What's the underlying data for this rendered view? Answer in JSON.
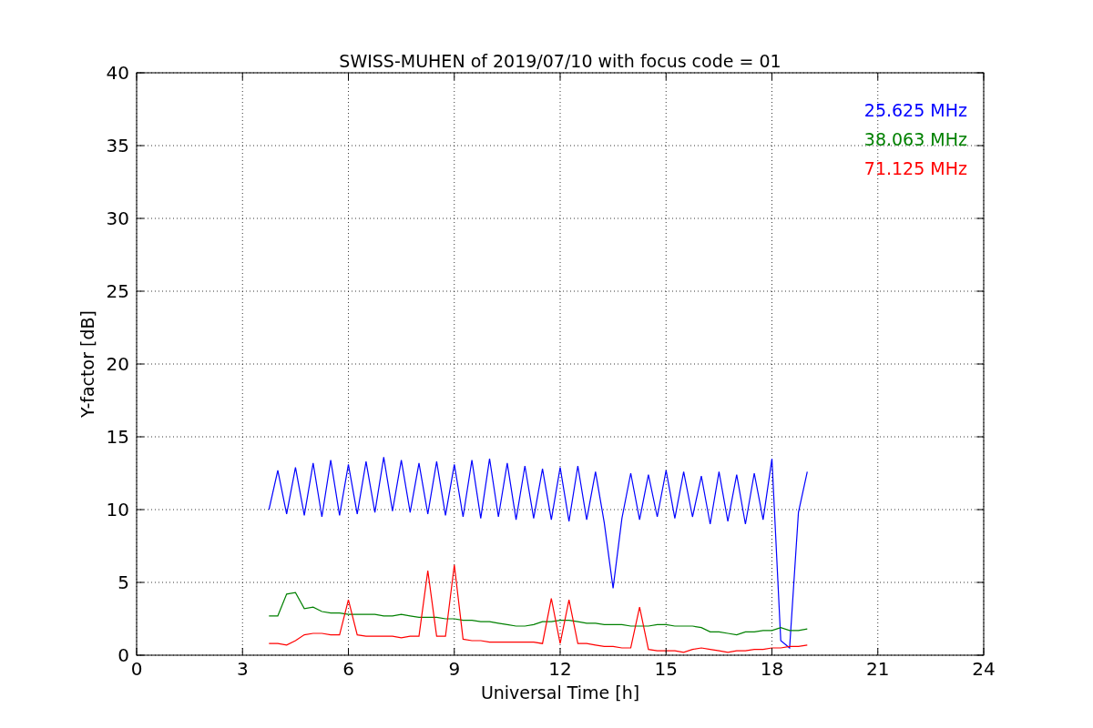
{
  "chart_data": {
    "type": "line",
    "title": "SWISS-MUHEN of 2019/07/10 with focus code = 01",
    "xlabel": "Universal Time [h]",
    "ylabel": "Y-factor [dB]",
    "x": [
      3.75,
      4,
      4.25,
      4.5,
      4.75,
      5,
      5.25,
      5.5,
      5.75,
      6,
      6.25,
      6.5,
      6.75,
      7,
      7.25,
      7.5,
      7.75,
      8,
      8.25,
      8.5,
      8.75,
      9,
      9.25,
      9.5,
      9.75,
      10,
      10.25,
      10.5,
      10.75,
      11,
      11.25,
      11.5,
      11.75,
      12,
      12.25,
      12.5,
      12.75,
      13,
      13.25,
      13.5,
      13.75,
      14,
      14.25,
      14.5,
      14.75,
      15,
      15.25,
      15.5,
      15.75,
      16,
      16.25,
      16.5,
      16.75,
      17,
      17.25,
      17.5,
      17.75,
      18,
      18.25,
      18.5,
      18.75,
      19
    ],
    "series": [
      {
        "name": "25.625 MHz",
        "color": "#0000ff",
        "values": [
          10,
          12.7,
          9.7,
          12.9,
          9.6,
          13.2,
          9.5,
          13.4,
          9.6,
          13.1,
          9.7,
          13.3,
          9.8,
          13.6,
          9.9,
          13.4,
          9.8,
          13.2,
          9.7,
          13.3,
          9.6,
          13.1,
          9.5,
          13.4,
          9.4,
          13.5,
          9.5,
          13.2,
          9.3,
          13.0,
          9.4,
          12.8,
          9.3,
          12.9,
          9.2,
          13.0,
          9.3,
          12.6,
          9.1,
          4.6,
          9.4,
          12.5,
          9.3,
          12.4,
          9.5,
          12.7,
          9.4,
          12.6,
          9.5,
          12.3,
          9.0,
          12.6,
          9.2,
          12.4,
          9.0,
          12.5,
          9.3,
          13.5,
          1.0,
          0.5,
          9.8,
          12.6
        ]
      },
      {
        "name": "38.063 MHz",
        "color": "#008000",
        "values": [
          2.7,
          2.7,
          4.2,
          4.3,
          3.2,
          3.3,
          3.0,
          2.9,
          2.9,
          2.8,
          2.8,
          2.8,
          2.8,
          2.7,
          2.7,
          2.8,
          2.7,
          2.6,
          2.6,
          2.6,
          2.5,
          2.5,
          2.4,
          2.4,
          2.3,
          2.3,
          2.2,
          2.1,
          2.0,
          2.0,
          2.1,
          2.3,
          2.3,
          2.4,
          2.4,
          2.3,
          2.2,
          2.2,
          2.1,
          2.1,
          2.1,
          2.0,
          2.0,
          2.0,
          2.1,
          2.1,
          2.0,
          2.0,
          2.0,
          1.9,
          1.6,
          1.6,
          1.5,
          1.4,
          1.6,
          1.6,
          1.7,
          1.7,
          1.9,
          1.7,
          1.7,
          1.8
        ]
      },
      {
        "name": "71.125 MHz",
        "color": "#ff0000",
        "values": [
          0.8,
          0.8,
          0.7,
          1.0,
          1.4,
          1.5,
          1.5,
          1.4,
          1.4,
          3.8,
          1.4,
          1.3,
          1.3,
          1.3,
          1.3,
          1.2,
          1.3,
          1.3,
          5.8,
          1.3,
          1.3,
          6.2,
          1.1,
          1.0,
          1.0,
          0.9,
          0.9,
          0.9,
          0.9,
          0.9,
          0.9,
          0.8,
          3.9,
          0.8,
          3.8,
          0.8,
          0.8,
          0.7,
          0.6,
          0.6,
          0.5,
          0.5,
          3.3,
          0.4,
          0.3,
          0.3,
          0.3,
          0.2,
          0.4,
          0.5,
          0.4,
          0.3,
          0.2,
          0.3,
          0.3,
          0.4,
          0.4,
          0.5,
          0.5,
          0.6,
          0.6,
          0.7
        ]
      }
    ],
    "grid": true,
    "xlim": [
      0,
      24
    ],
    "ylim": [
      0,
      40
    ],
    "xticks": [
      0,
      3,
      6,
      9,
      12,
      15,
      18,
      21,
      24
    ],
    "yticks": [
      0,
      5,
      10,
      15,
      20,
      25,
      30,
      35,
      40
    ]
  }
}
